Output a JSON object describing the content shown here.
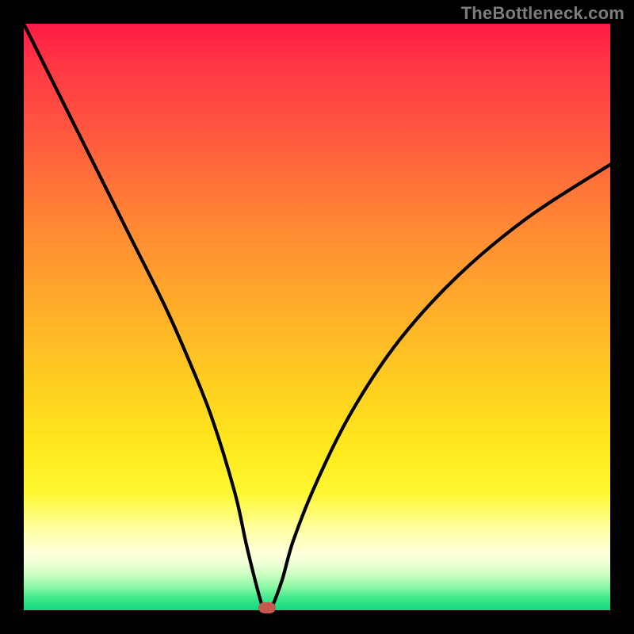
{
  "watermark": "TheBottleneck.com",
  "chart_data": {
    "type": "line",
    "title": "",
    "xlabel": "",
    "ylabel": "",
    "xlim": [
      0,
      100
    ],
    "ylim": [
      0,
      100
    ],
    "grid": false,
    "legend": false,
    "background_gradient": {
      "orientation": "vertical",
      "stops": [
        {
          "pos": 0,
          "color": "#ff1a45"
        },
        {
          "pos": 18,
          "color": "#ff5640"
        },
        {
          "pos": 50,
          "color": "#ffb129"
        },
        {
          "pos": 80,
          "color": "#fff730"
        },
        {
          "pos": 92,
          "color": "#d8ffcc"
        },
        {
          "pos": 100,
          "color": "#11d980"
        }
      ]
    },
    "series": [
      {
        "name": "bottleneck-curve",
        "x": [
          0,
          6,
          12,
          18,
          24,
          28,
          32,
          36,
          38,
          40,
          41,
          42,
          44,
          46,
          50,
          56,
          64,
          74,
          86,
          100
        ],
        "y": [
          100,
          88,
          76,
          64,
          52,
          43,
          33,
          20,
          11,
          3,
          0,
          0,
          5,
          12,
          22,
          34,
          46,
          57,
          67,
          76
        ]
      }
    ],
    "marker": {
      "x": 41.5,
      "y": 0,
      "color": "#c5594e"
    }
  }
}
